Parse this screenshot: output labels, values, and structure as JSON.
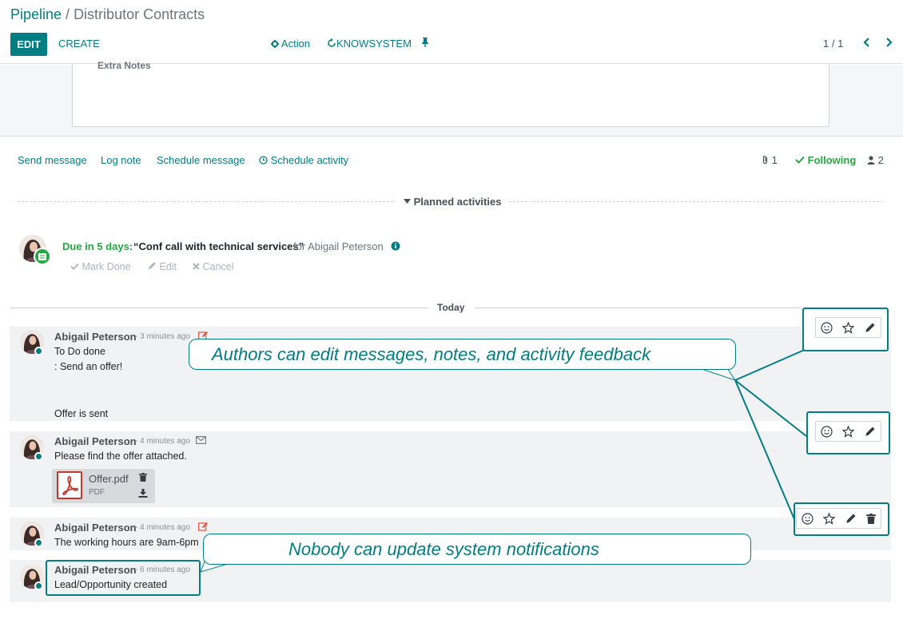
{
  "breadcrumb": {
    "parent": "Pipeline",
    "separator": " / ",
    "current": "Distributor Contracts"
  },
  "toolbar": {
    "edit_label": "EDIT",
    "create_label": "CREATE",
    "action_label": "Action",
    "knowsystem_label": "KNOWSYSTEM"
  },
  "pager": {
    "value": "1 / 1"
  },
  "sheet": {
    "extra_notes_label": "Extra Notes"
  },
  "chatter": {
    "send_message": "Send message",
    "log_note": "Log note",
    "schedule_message": "Schedule message",
    "schedule_activity": "Schedule activity",
    "attachments_count": "1",
    "following_label": "Following",
    "followers_count": "2"
  },
  "planned_activities": {
    "title": "Planned activities",
    "due": "Due in 5 days:",
    "summary": "“Conf call with technical services”",
    "for_text": "for Abigail Peterson",
    "mark_done": "Mark Done",
    "edit": "Edit",
    "cancel": "Cancel"
  },
  "today_label": "Today",
  "messages": [
    {
      "author": "Abigail Peterson",
      "date": "- 3 minutes ago",
      "line1": "To Do done",
      "line2": ": Send an offer!",
      "line3": "Offer is sent"
    },
    {
      "author": "Abigail Peterson",
      "date": "- 4 minutes ago",
      "line1": "Please find the offer attached."
    },
    {
      "author": "Abigail Peterson",
      "date": "- 4 minutes ago",
      "line1": "The working hours are 9am-6pm"
    },
    {
      "author": "Abigail Peterson",
      "date": "- 6 minutes ago",
      "line1": "Lead/Opportunity created"
    }
  ],
  "attachment": {
    "name": "Offer.pdf",
    "ext": "PDF"
  },
  "annotations": {
    "edit_callout": "Authors can edit messages, notes, and activity feedback",
    "system_callout": "Nobody can update system notifications"
  },
  "colors": {
    "brand": "#017e84",
    "success": "#28a745",
    "note_icon": "#e74c3c"
  }
}
